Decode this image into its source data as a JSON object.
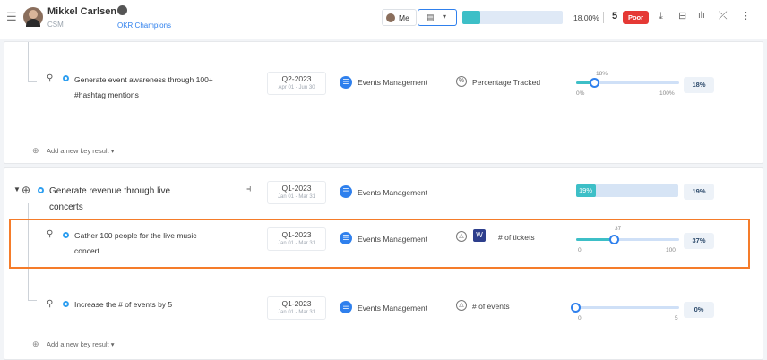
{
  "header": {
    "user_name": "Mikkel Carlsen",
    "user_role": "CSM",
    "group_name": "OKR Champions",
    "me_label": "Me",
    "progress_percent": 18,
    "progress_text": "18.00%",
    "score": "5",
    "score_badge": "Poor",
    "colors": {
      "accent": "#3dbfc7",
      "badge": "#e53935",
      "link": "#2f80ed"
    }
  },
  "section1": {
    "kr": {
      "title_line1": "Generate event awareness through 100+",
      "title_line2": "#hashtag mentions",
      "period": "Q2-2023",
      "period_range": "Apr 01 - Jun 30",
      "team": "Events Management",
      "metric": "Percentage Tracked",
      "value_label": "18%",
      "min_label": "0%",
      "max_label": "100%",
      "progress": 0.18,
      "badge": "18%"
    },
    "add_kr": "Add a new key result ▾"
  },
  "section2": {
    "objective": {
      "title_line1": "Generate revenue through live",
      "title_line2": "concerts",
      "period": "Q1-2023",
      "period_range": "Jan 01 - Mar 31",
      "team": "Events Management",
      "bar_label": "19%",
      "progress": 0.19,
      "badge": "19%"
    },
    "kr_selected": {
      "title_line1": "Gather 100 people for the live music",
      "title_line2": "concert",
      "period": "Q1-2023",
      "period_range": "Jan 01 - Mar 31",
      "team": "Events Management",
      "metric": "# of tickets",
      "value_label": "37",
      "min_label": "0",
      "max_label": "100",
      "progress": 0.37,
      "badge": "37%"
    },
    "kr3": {
      "title": "Increase the # of events by 5",
      "period": "Q1-2023",
      "period_range": "Jan 01 - Mar 31",
      "team": "Events Management",
      "metric": "# of events",
      "min_label": "0",
      "max_label": "5",
      "progress": 0,
      "badge": "0%"
    },
    "add_kr": "Add a new key result ▾"
  }
}
